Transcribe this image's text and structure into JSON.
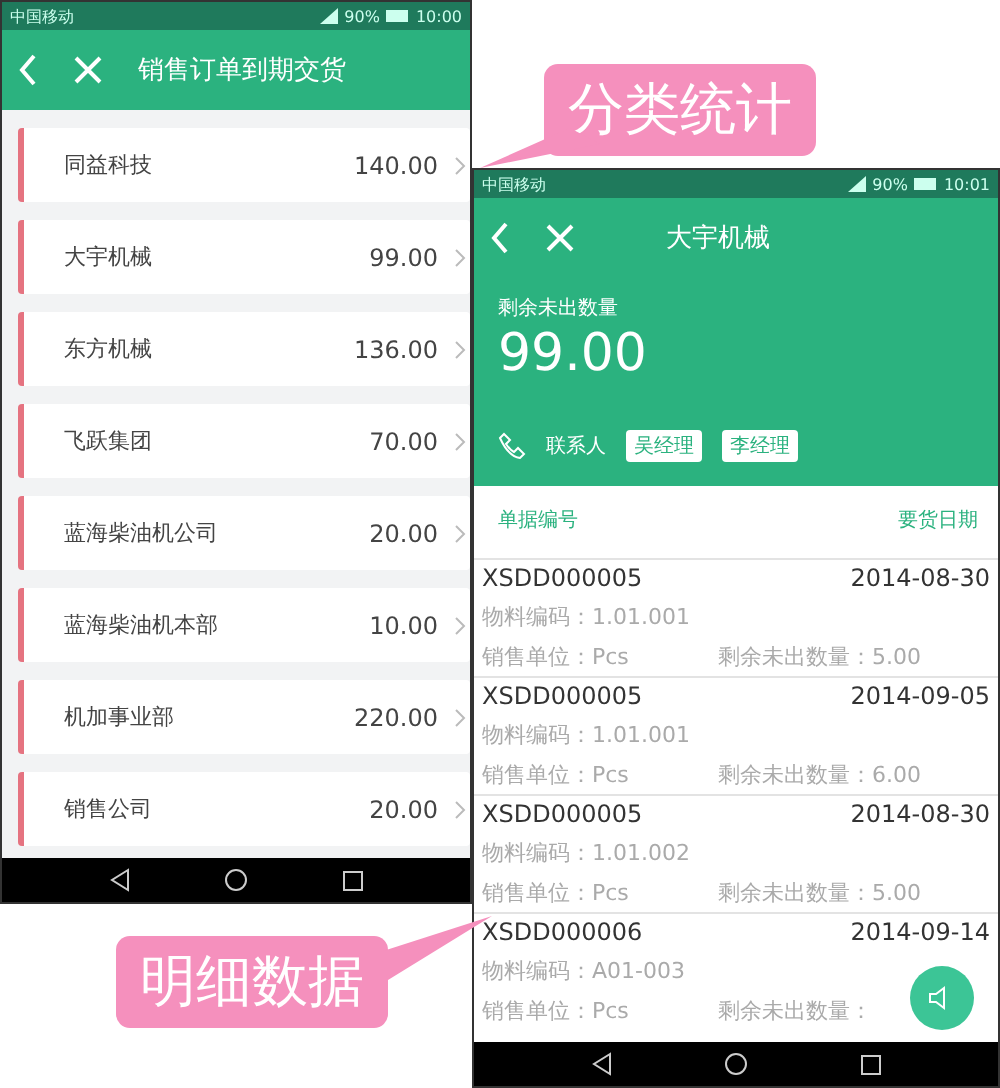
{
  "callouts": [
    {
      "text": "分类统计",
      "kind": "top"
    },
    {
      "text": "明细数据",
      "kind": "bottom"
    }
  ],
  "list_screen": {
    "status_bar": {
      "carrier": "中国移动",
      "battery": "90%",
      "time": "10:00"
    },
    "title": "销售订单到期交货",
    "items": [
      {
        "name": "同益科技",
        "amount": "140.00"
      },
      {
        "name": "大宇机械",
        "amount": "99.00"
      },
      {
        "name": "东方机械",
        "amount": "136.00"
      },
      {
        "name": "飞跃集团",
        "amount": "70.00"
      },
      {
        "name": "蓝海柴油机公司",
        "amount": "20.00"
      },
      {
        "name": "蓝海柴油机本部",
        "amount": "10.00"
      },
      {
        "name": "机加事业部",
        "amount": "220.00"
      },
      {
        "name": "销售公司",
        "amount": "20.00"
      }
    ]
  },
  "detail_screen": {
    "status_bar": {
      "carrier": "中国移动",
      "battery": "90%",
      "time": "10:01"
    },
    "title": "大宇机械",
    "summary_label": "剩余未出数量",
    "summary_value": "99.00",
    "contact_label": "联系人",
    "contacts": [
      "吴经理",
      "李经理"
    ],
    "columns": [
      "单据编号",
      "要货日期"
    ],
    "rows": [
      {
        "order_no": "XSDD000005",
        "date": "2014-08-30",
        "material": "物料编码：1.01.001",
        "unit": "销售单位：Pcs",
        "remaining": "剩余未出数量：5.00"
      },
      {
        "order_no": "XSDD000005",
        "date": "2014-09-05",
        "material": "物料编码：1.01.001",
        "unit": "销售单位：Pcs",
        "remaining": "剩余未出数量：6.00"
      },
      {
        "order_no": "XSDD000005",
        "date": "2014-08-30",
        "material": "物料编码：1.01.002",
        "unit": "销售单位：Pcs",
        "remaining": "剩余未出数量：5.00"
      },
      {
        "order_no": "XSDD000006",
        "date": "2014-09-14",
        "material": "物料编码：A01-003",
        "unit": "销售单位：Pcs",
        "remaining": "剩余未出数量："
      }
    ]
  }
}
